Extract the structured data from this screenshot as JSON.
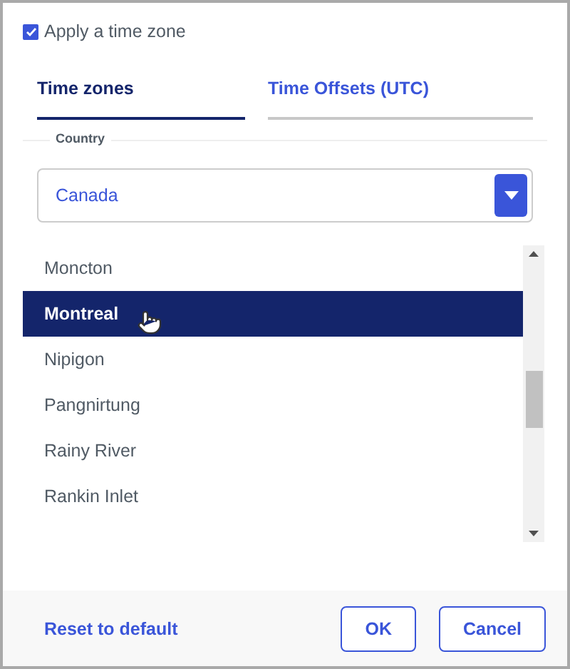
{
  "apply_time_zone": {
    "label": "Apply a time zone",
    "checked": true
  },
  "tabs": [
    {
      "label": "Time zones",
      "selected": true
    },
    {
      "label": "Time Offsets (UTC)",
      "selected": false
    }
  ],
  "country": {
    "legend": "Country",
    "value": "Canada"
  },
  "cities": [
    {
      "name": "Moncton",
      "selected": false
    },
    {
      "name": "Montreal",
      "selected": true
    },
    {
      "name": "Nipigon",
      "selected": false
    },
    {
      "name": "Pangnirtung",
      "selected": false
    },
    {
      "name": "Rainy River",
      "selected": false
    },
    {
      "name": "Rankin Inlet",
      "selected": false
    }
  ],
  "footer": {
    "reset": "Reset to default",
    "buttons": [
      "OK",
      "Cancel"
    ]
  }
}
